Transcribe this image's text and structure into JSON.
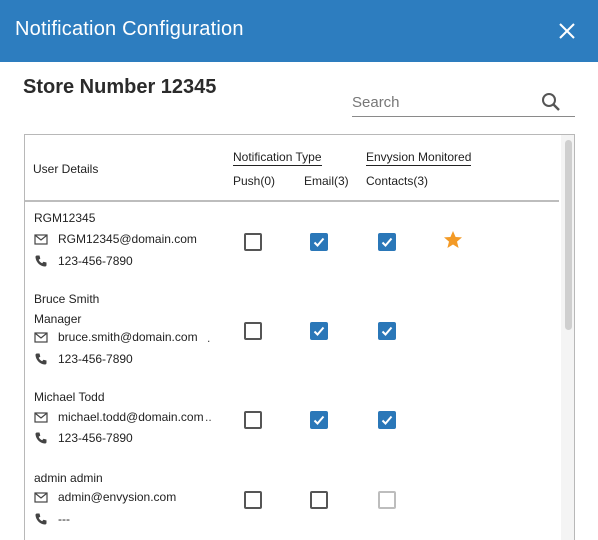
{
  "dialog": {
    "title": "Notification Configuration",
    "close_icon": "close-icon"
  },
  "store": {
    "title": "Store Number 12345"
  },
  "search": {
    "placeholder": "Search",
    "value": "",
    "icon": "search-icon"
  },
  "table": {
    "headers": {
      "user_details": "User Details",
      "notification_type": "Notification Type",
      "push": "Push(0)",
      "email": "Email(3)",
      "envysion_monitored": "Envysion Monitored",
      "contacts": "Contacts(3)"
    },
    "rows": [
      {
        "name": "RGM12345",
        "role": "",
        "email": "RGM12345@domain.com",
        "phone": "123-456-7890",
        "push": false,
        "email_checked": true,
        "contacts": true,
        "contacts_disabled": false,
        "starred": true
      },
      {
        "name": "Bruce Smith",
        "role": "Manager",
        "email": "bruce.smith@domain.com",
        "phone": "123-456-7890",
        "push": false,
        "email_checked": true,
        "contacts": true,
        "contacts_disabled": false,
        "starred": false
      },
      {
        "name": "Michael Todd",
        "role": "",
        "email": "michael.todd@domain.com",
        "phone": "123-456-7890",
        "push": false,
        "email_checked": true,
        "contacts": true,
        "contacts_disabled": false,
        "starred": false
      },
      {
        "name": "admin admin",
        "role": "",
        "email": "admin@envysion.com",
        "phone": "---",
        "push": false,
        "email_checked": false,
        "contacts": false,
        "contacts_disabled": true,
        "starred": false
      }
    ]
  },
  "colors": {
    "header_bg": "#2d7dbf",
    "checkbox_checked": "#2a77b8",
    "star": "#f39a26"
  }
}
